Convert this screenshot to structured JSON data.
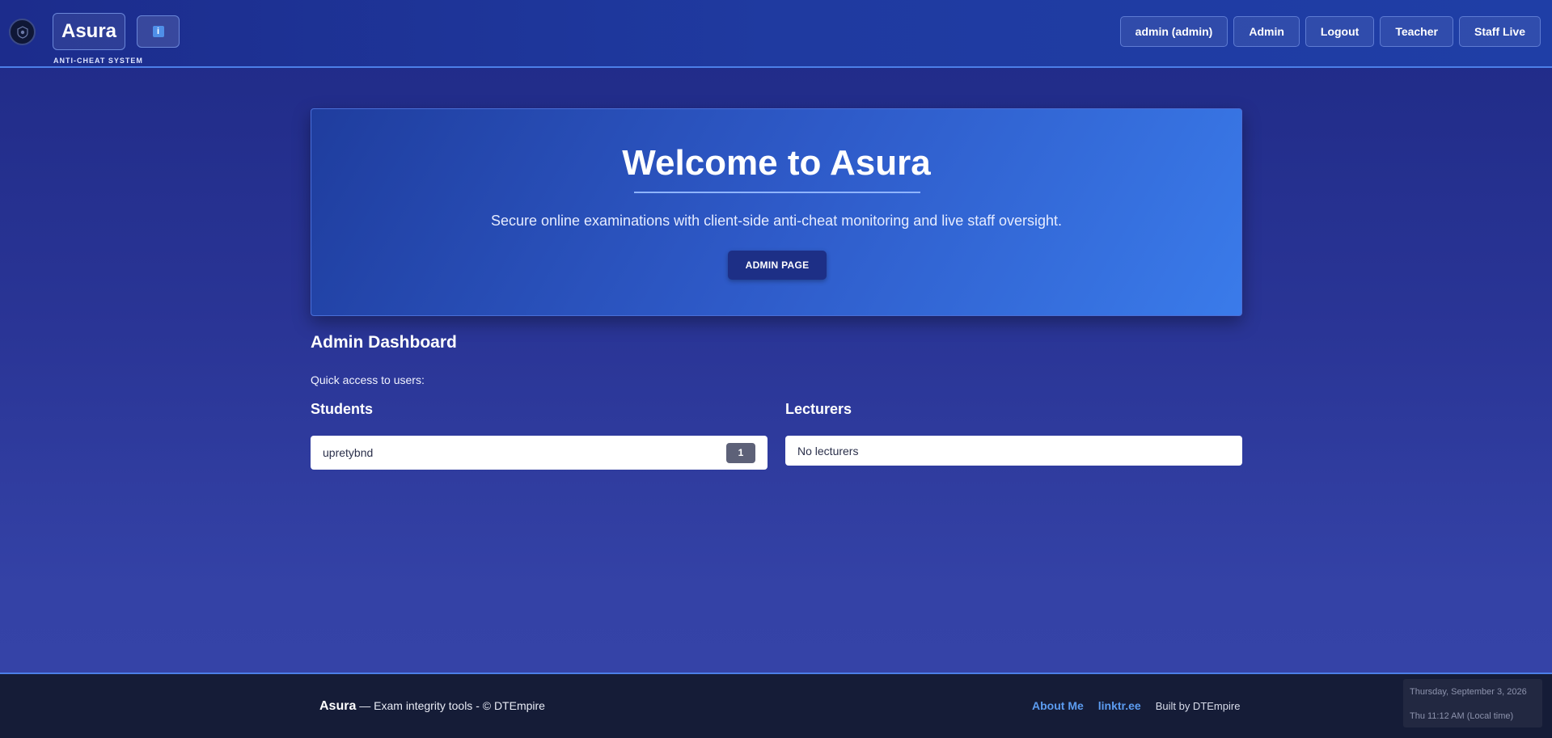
{
  "header": {
    "brand": "Asura",
    "brand_subtitle": "ANTI-CHEAT SYSTEM",
    "info_icon": "info-icon",
    "nav": [
      {
        "label": "admin (admin)"
      },
      {
        "label": "Admin"
      },
      {
        "label": "Logout"
      },
      {
        "label": "Teacher"
      },
      {
        "label": "Staff Live"
      }
    ]
  },
  "hero": {
    "title": "Welcome to Asura",
    "subtitle": "Secure online examinations with client-side anti-cheat monitoring and live staff oversight.",
    "button": "ADMIN PAGE"
  },
  "dashboard": {
    "title": "Admin Dashboard",
    "subtitle": "Quick access to users:",
    "students": {
      "title": "Students",
      "items": [
        {
          "name": "upretybnd",
          "count": "1"
        }
      ]
    },
    "lecturers": {
      "title": "Lecturers",
      "empty": "No lecturers"
    }
  },
  "footer": {
    "brand": "Asura",
    "tagline": "— Exam integrity tools - © DTEmpire",
    "links": [
      "About Me",
      "linktr.ee"
    ],
    "built_by": "Built by DTEmpire",
    "date": "Thursday, September 3, 2026",
    "time": "Thu 11:12 AM (Local time)"
  },
  "colors": {
    "accent": "#4c7fe8",
    "header_bg": "#1f3aa0",
    "footer_bg": "#151c37",
    "link": "#5c9cf0"
  }
}
